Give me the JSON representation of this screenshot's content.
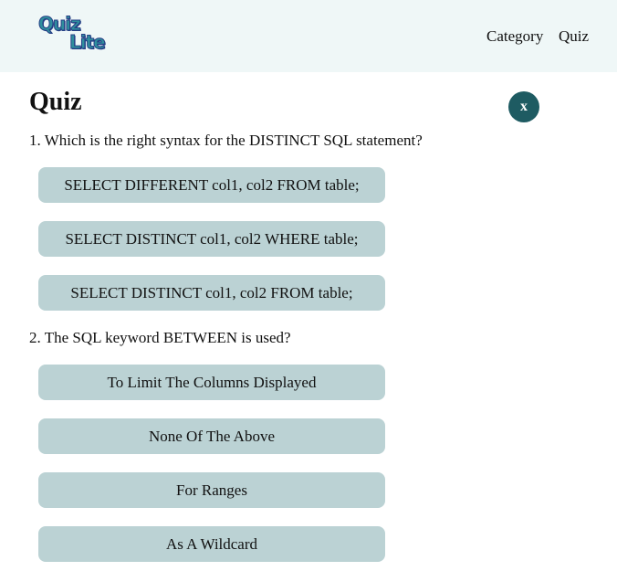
{
  "header": {
    "logo_text_1": "Quiz",
    "logo_text_2": "Lite",
    "nav": [
      {
        "label": "Category"
      },
      {
        "label": "Quiz"
      }
    ]
  },
  "main": {
    "title": "Quiz",
    "close_label": "x",
    "questions": [
      {
        "text": "1. Which is the right syntax for the DISTINCT SQL statement?",
        "options": [
          "SELECT DIFFERENT col1, col2 FROM table;",
          "SELECT DISTINCT col1, col2 WHERE table;",
          "SELECT DISTINCT col1, col2 FROM table;"
        ]
      },
      {
        "text": "2. The SQL keyword BETWEEN is used?",
        "options": [
          "To Limit The Columns Displayed",
          "None Of The Above",
          "For Ranges",
          "As A Wildcard"
        ]
      }
    ]
  },
  "colors": {
    "header_bg": "#eff7f7",
    "option_bg": "#bbd2d4",
    "close_bg": "#1e5b62",
    "logo_fill": "#2f8f9d",
    "logo_outline": "#263f86"
  }
}
